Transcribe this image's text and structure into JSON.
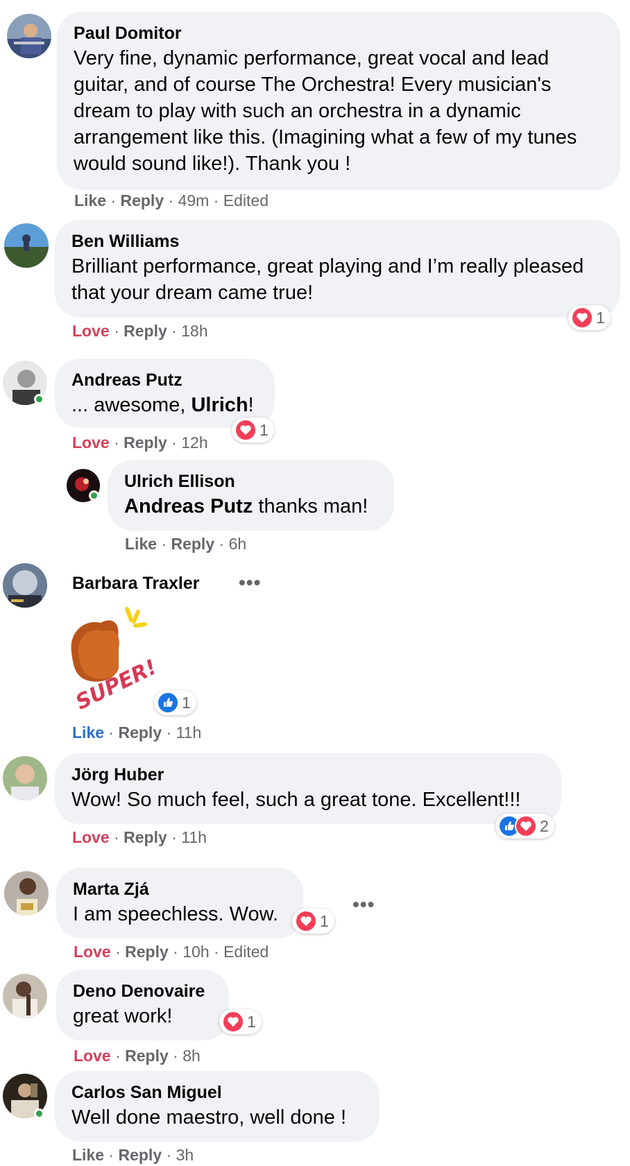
{
  "colors": {
    "bubble": "#f0f2f5",
    "love": "#d63f5a",
    "like_blue": "#2d6fc6",
    "meta": "#65676b",
    "heart_reaction": "#f33e58",
    "like_reaction": "#1b74e4",
    "online": "#31a24c"
  },
  "comments": [
    {
      "author": "Paul Domitor",
      "text": "Very fine, dynamic performance, great vocal and lead guitar, and of course The Orchestra! Every musician's dream to play with such an orchestra in a dynamic arrangement like this. (Imagining what a few of my tunes would sound like!). Thank you !",
      "action": "Like",
      "reply": "Reply",
      "time": "49m",
      "edited": "Edited"
    },
    {
      "author": "Ben Williams",
      "text": "Brilliant performance, great playing and I’m really pleased that your dream came true!",
      "action": "Love",
      "reply": "Reply",
      "time": "18h",
      "reaction_count": "1"
    },
    {
      "author": "Andreas Putz",
      "text_prefix": "... awesome, ",
      "mention": "Ulrich",
      "text_suffix": "!",
      "action": "Love",
      "reply": "Reply",
      "time": "12h",
      "reaction_count": "1"
    },
    {
      "author": "Ulrich Ellison",
      "mention": "Andreas Putz",
      "text_suffix": " thanks man!",
      "action": "Like",
      "reply": "Reply",
      "time": "6h"
    },
    {
      "author": "Barbara Traxler",
      "sticker_text": "SUPER!",
      "action": "Like",
      "reply": "Reply",
      "time": "11h",
      "reaction_count": "1"
    },
    {
      "author": "Jörg Huber",
      "text": "Wow! So much feel, such a great tone. Excellent!!!",
      "action": "Love",
      "reply": "Reply",
      "time": "11h",
      "reaction_count": "2"
    },
    {
      "author": "Marta Zjá",
      "text": "I am speechless. Wow.",
      "action": "Love",
      "reply": "Reply",
      "time": "10h",
      "edited": "Edited",
      "reaction_count": "1"
    },
    {
      "author": "Deno Denovaire",
      "text": "great work!",
      "action": "Love",
      "reply": "Reply",
      "time": "8h",
      "reaction_count": "1"
    },
    {
      "author": "Carlos San Miguel",
      "text": "Well done maestro, well done !",
      "action": "Like",
      "reply": "Reply",
      "time": "3h"
    }
  ],
  "icons": {
    "more": "more-options-icon",
    "heart": "heart-reaction-icon",
    "like": "like-reaction-icon"
  },
  "dots": "•••",
  "sep": " · "
}
